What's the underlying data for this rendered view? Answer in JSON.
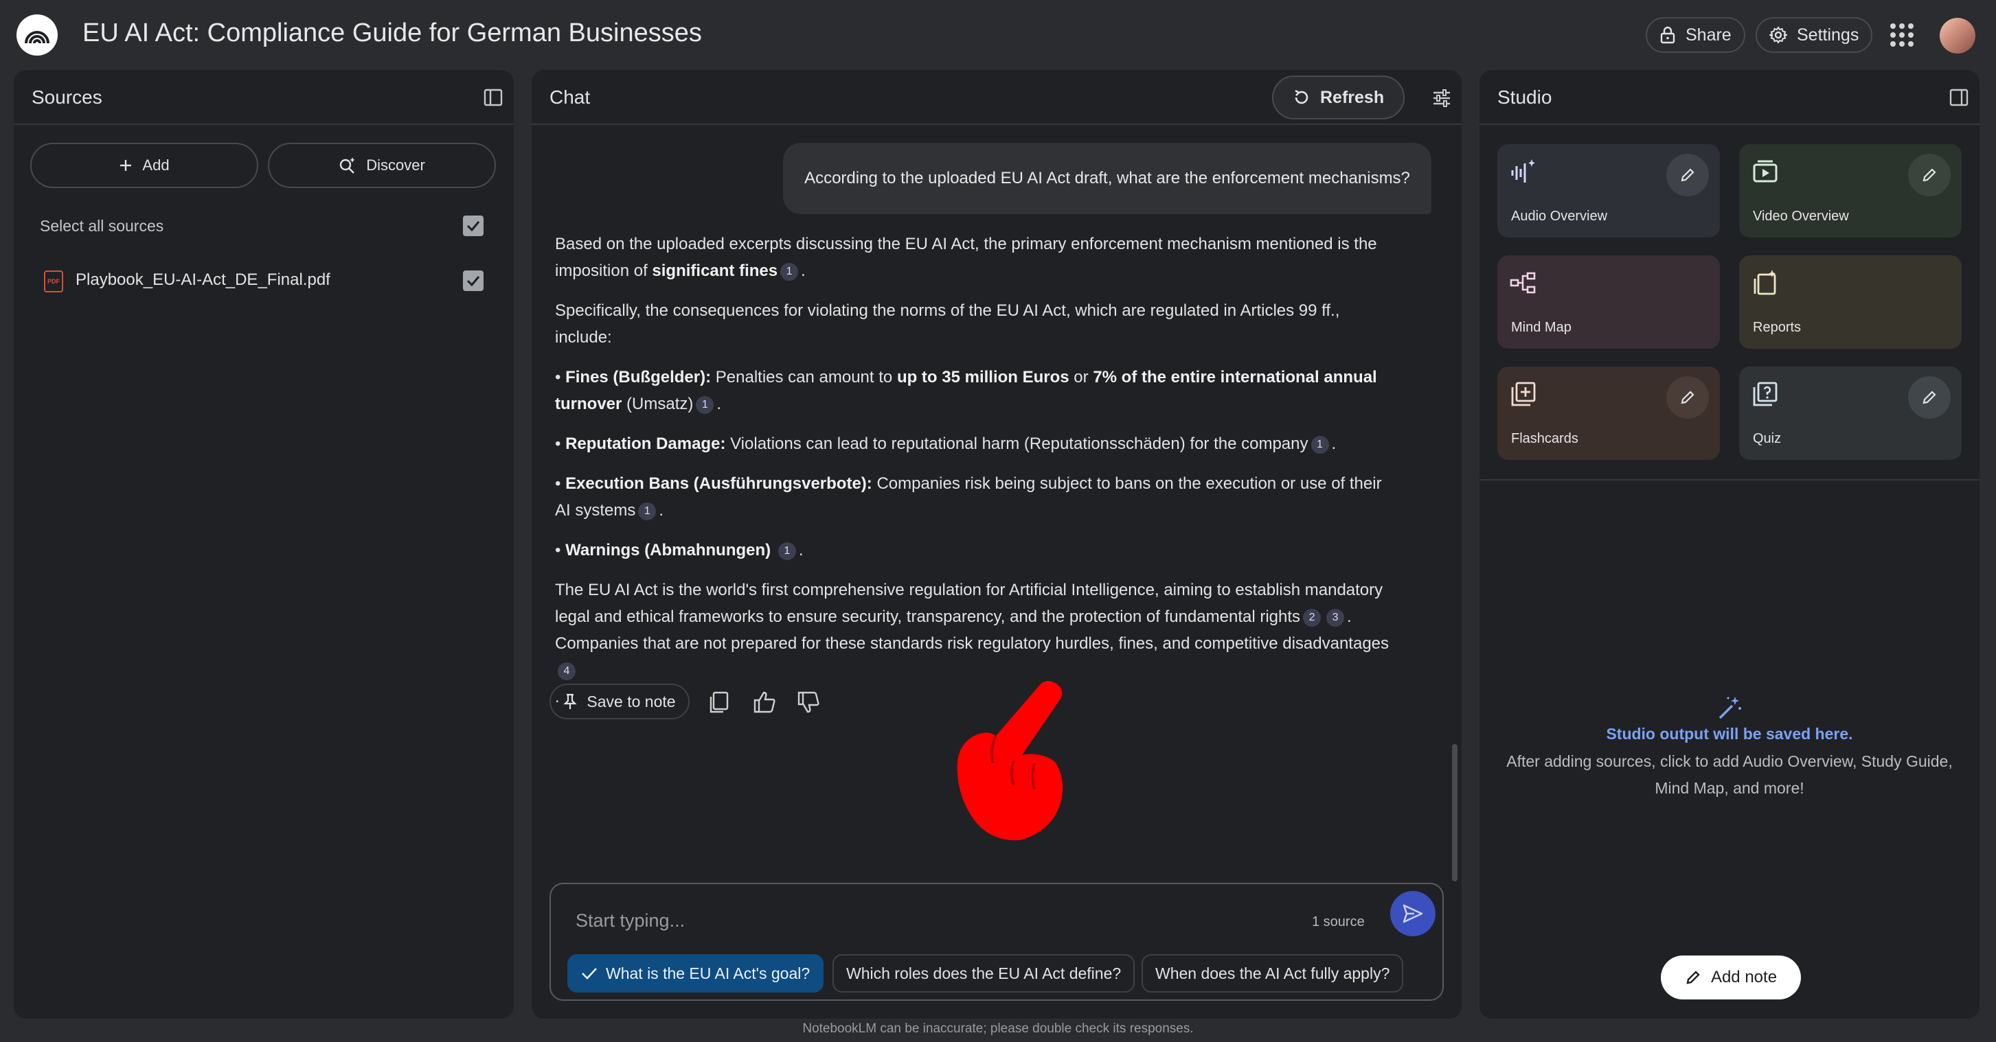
{
  "header": {
    "title": "EU AI Act: Compliance Guide for German Businesses",
    "share_label": "Share",
    "settings_label": "Settings"
  },
  "sources": {
    "title": "Sources",
    "add_label": "Add",
    "discover_label": "Discover",
    "select_all_label": "Select all sources",
    "select_all_checked": true,
    "items": [
      {
        "name": "Playbook_EU-AI-Act_DE_Final.pdf",
        "type": "pdf",
        "checked": true
      }
    ]
  },
  "chat": {
    "title": "Chat",
    "refresh_label": "Refresh",
    "user_message": "According to the uploaded EU AI Act draft, what are the enforcement mechanisms?",
    "answer": {
      "p1_a": "Based on the uploaded excerpts discussing the EU AI Act, the primary enforcement mechanism mentioned is the imposition of ",
      "p1_b": "significant fines",
      "p2": "Specifically, the consequences for violating the norms of the EU AI Act, which are regulated in Articles 99 ff., include:",
      "b1_title": "Fines (Bußgelder):",
      "b1_a": " Penalties can amount to ",
      "b1_b": "up to 35 million Euros",
      "b1_c": " or ",
      "b1_d": "7% of the entire international annual turnover",
      "b1_e": " (Umsatz)",
      "b2_title": "Reputation Damage:",
      "b2_text": " Violations can lead to reputational harm (Reputationsschäden) for the company",
      "b3_title": "Execution Bans (Ausführungsverbote):",
      "b3_text": " Companies risk being subject to bans on the execution or use of their AI systems",
      "b4_title": "Warnings (Abmahnungen)",
      "p3_a": "The EU AI Act is the world's first comprehensive regulation for Artificial Intelligence, aiming to establish mandatory legal and ethical frameworks to ensure security, transparency, and the protection of fundamental rights",
      "p3_b": ". Companies that are not prepared for these standards risk regulatory hurdles, fines, and competitive disadvantages",
      "p3_end": ".",
      "bullet": "•",
      "period": ".",
      "cite_1": "1",
      "cite_2": "2",
      "cite_3": "3",
      "cite_4": "4"
    },
    "save_to_note_label": "Save to note",
    "input_placeholder": "Start typing...",
    "source_count": "1 source",
    "suggestions": [
      "What is the EU AI Act's goal?",
      "Which roles does the EU AI Act define?",
      "When does the AI Act fully apply?"
    ]
  },
  "studio": {
    "title": "Studio",
    "cards": [
      {
        "label": "Audio Overview",
        "icon": "audio-waveform-icon",
        "color": "#2d3036",
        "editable": true
      },
      {
        "label": "Video Overview",
        "icon": "video-icon",
        "color": "#2b332d",
        "editable": true
      },
      {
        "label": "Mind Map",
        "icon": "mind-map-icon",
        "color": "#3a2e35",
        "editable": false
      },
      {
        "label": "Reports",
        "icon": "reports-icon",
        "color": "#37352b",
        "editable": false
      },
      {
        "label": "Flashcards",
        "icon": "flashcards-icon",
        "color": "#3a2f2b",
        "editable": true
      },
      {
        "label": "Quiz",
        "icon": "quiz-icon",
        "color": "#2f3335",
        "editable": true
      }
    ],
    "empty_title": "Studio output will be saved here.",
    "empty_text": "After adding sources, click to add Audio Overview, Study Guide, Mind Map, and more!",
    "add_note_label": "Add note"
  },
  "footer": {
    "disclaimer": "NotebookLM can be inaccurate; please double check its responses."
  },
  "colors": {
    "background": "#2b2c2f",
    "panel": "#202124",
    "accent": "#a8c7fa",
    "send_button": "#3b4fbf",
    "selected_chip": "#0f4c81",
    "pointer_hand": "#ff0000"
  }
}
